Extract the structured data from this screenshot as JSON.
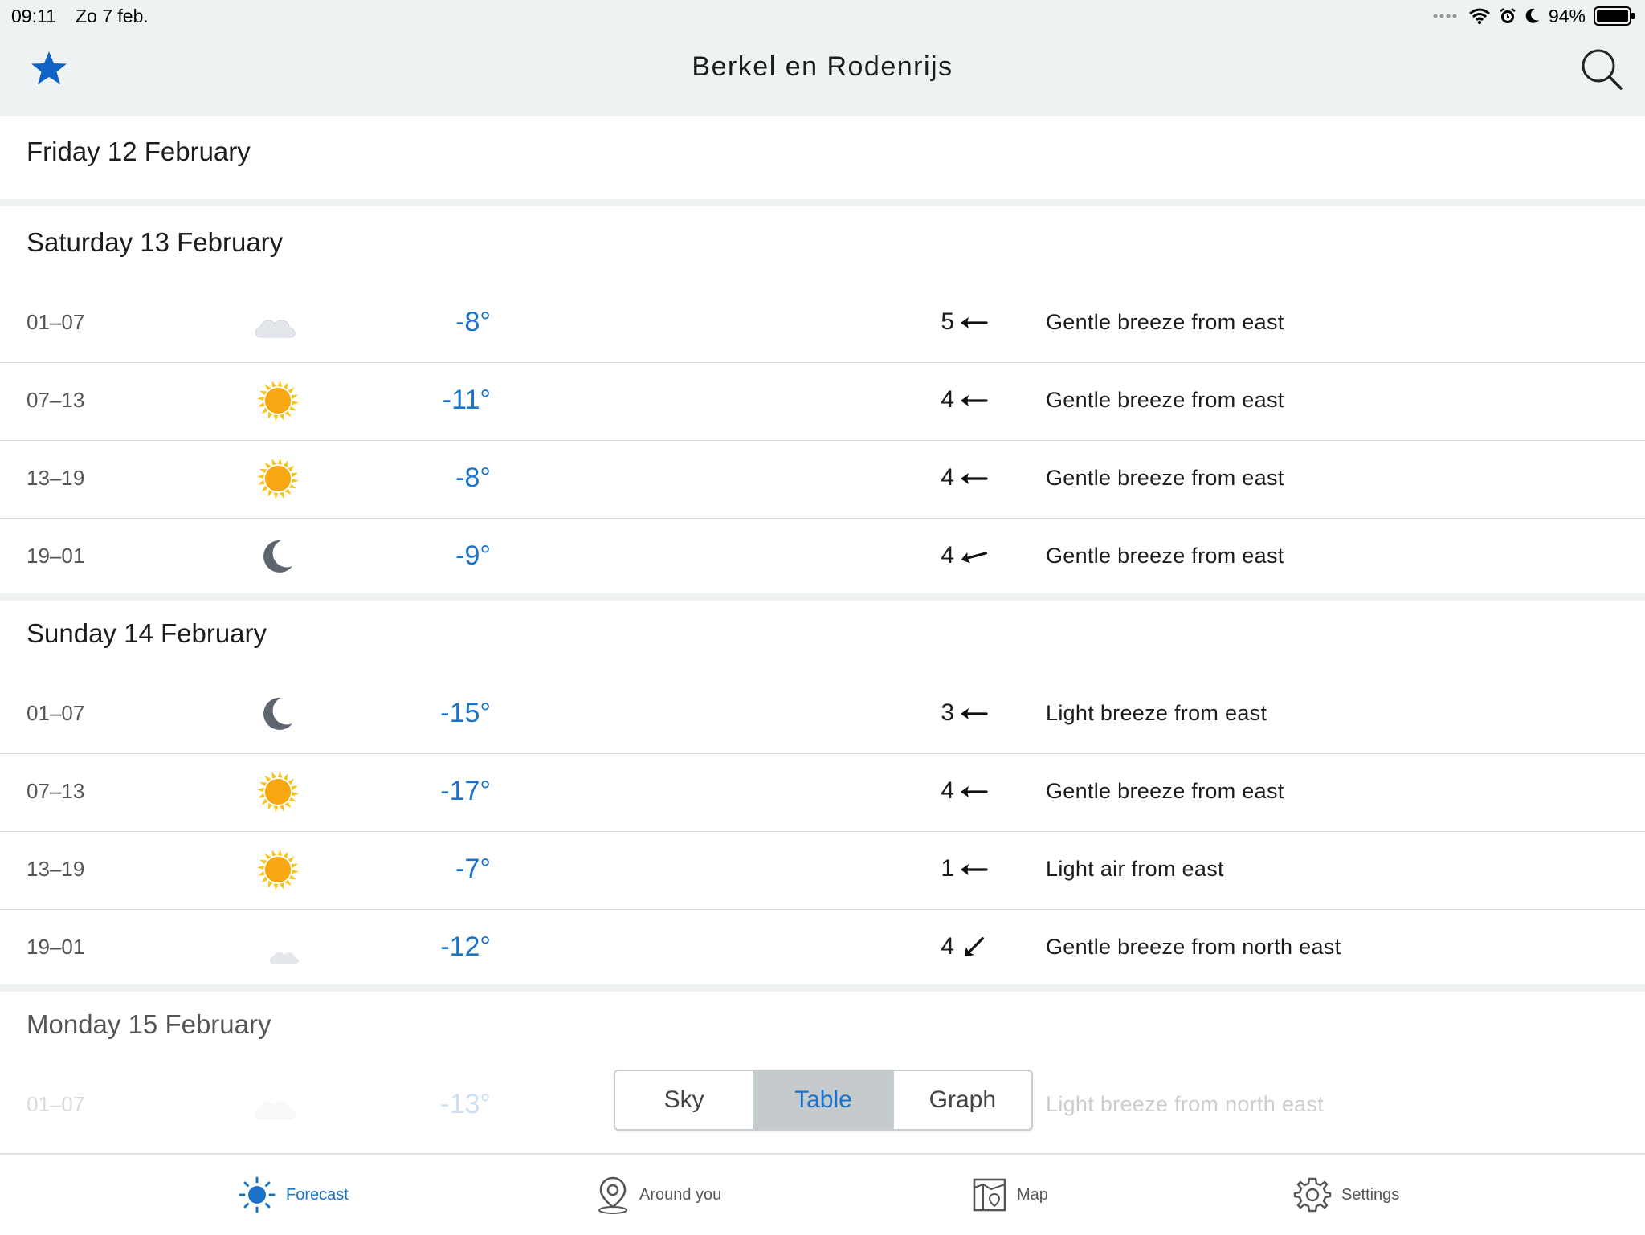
{
  "status_bar": {
    "time": "09:11",
    "date": "Zo 7 feb.",
    "battery": "94%"
  },
  "nav": {
    "title": "Berkel en Rodenrijs",
    "favorite_icon": "star-icon",
    "search_icon": "search-icon"
  },
  "days": [
    {
      "title": "Friday 12 February",
      "rows": []
    },
    {
      "title": "Saturday 13 February",
      "rows": [
        {
          "period": "01–07",
          "sky": "cloud-moon",
          "temp": "-8°",
          "wind_speed": "5",
          "wind_dir": "east",
          "wind_desc": "Gentle breeze from east"
        },
        {
          "period": "07–13",
          "sky": "sun",
          "temp": "-11°",
          "wind_speed": "4",
          "wind_dir": "east",
          "wind_desc": "Gentle breeze from east"
        },
        {
          "period": "13–19",
          "sky": "sun",
          "temp": "-8°",
          "wind_speed": "4",
          "wind_dir": "east",
          "wind_desc": "Gentle breeze from east"
        },
        {
          "period": "19–01",
          "sky": "moon",
          "temp": "-9°",
          "wind_speed": "4",
          "wind_dir": "east-north-east",
          "wind_desc": "Gentle breeze from east"
        }
      ]
    },
    {
      "title": "Sunday 14 February",
      "rows": [
        {
          "period": "01–07",
          "sky": "moon",
          "temp": "-15°",
          "wind_speed": "3",
          "wind_dir": "east",
          "wind_desc": "Light breeze from east"
        },
        {
          "period": "07–13",
          "sky": "sun",
          "temp": "-17°",
          "wind_speed": "4",
          "wind_dir": "east",
          "wind_desc": "Gentle breeze from east"
        },
        {
          "period": "13–19",
          "sky": "sun",
          "temp": "-7°",
          "wind_speed": "1",
          "wind_dir": "east",
          "wind_desc": "Light air from east"
        },
        {
          "period": "19–01",
          "sky": "moon-cloud",
          "temp": "-12°",
          "wind_speed": "4",
          "wind_dir": "north-east",
          "wind_desc": "Gentle breeze from north east"
        }
      ]
    },
    {
      "title": "Monday 15 February",
      "rows": [
        {
          "period": "01–07",
          "sky": "cloud",
          "temp": "-13°",
          "wind_speed": "",
          "wind_dir": "",
          "wind_desc": "Light breeze from north east"
        }
      ]
    }
  ],
  "view_toggle": {
    "options": [
      "Sky",
      "Table",
      "Graph"
    ],
    "selected": "Table"
  },
  "tabs": [
    {
      "label": "Forecast",
      "icon": "sun-icon",
      "active": true
    },
    {
      "label": "Around you",
      "icon": "location-pin-icon",
      "active": false
    },
    {
      "label": "Map",
      "icon": "map-icon",
      "active": false
    },
    {
      "label": "Settings",
      "icon": "gear-icon",
      "active": false
    }
  ],
  "colors": {
    "accent": "#1a73c9",
    "header_bg": "#eef2f3"
  }
}
